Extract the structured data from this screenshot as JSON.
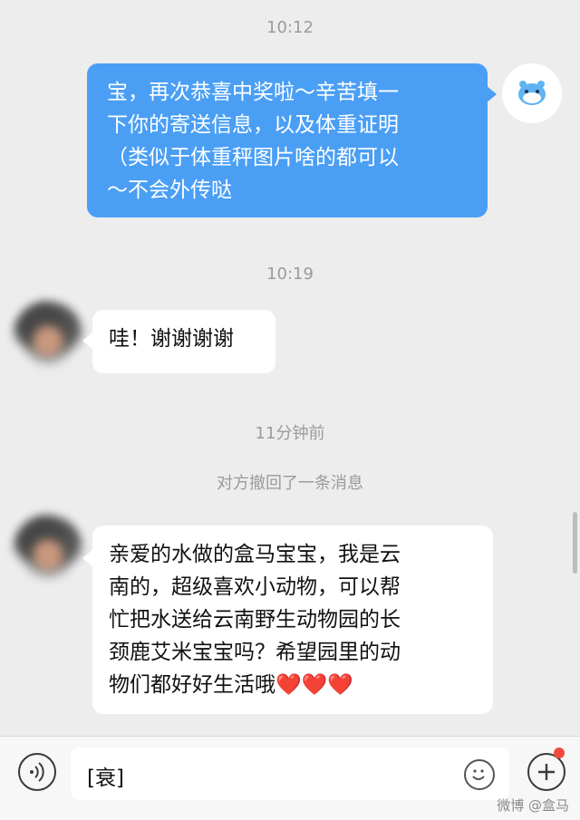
{
  "chat": {
    "timestamps": [
      "10:12",
      "10:19",
      "11分钟前"
    ],
    "messages": [
      {
        "from": "self",
        "lines": [
          "宝，再次恭喜中奖啦～辛苦填一",
          "下你的寄送信息，以及体重证明",
          "（类似于体重秤图片啥的都可以",
          "～不会外传哒"
        ]
      },
      {
        "from": "other",
        "lines": [
          "哇！谢谢谢谢"
        ]
      },
      {
        "from": "other",
        "lines": [
          "亲爱的水做的盒马宝宝，我是云",
          "南的，超级喜欢小动物，可以帮",
          "忙把水送给云南野生动物园的长",
          "颈鹿艾米宝宝吗？希望园里的动",
          "物们都好好生活哦"
        ],
        "trailing_emoji": "❤️❤️❤️"
      }
    ],
    "system_notes": [
      "对方撤回了一条消息"
    ]
  },
  "input_bar": {
    "text_value": "[衰]",
    "voice_icon": "voice-icon",
    "emoji_icon": "emoji-icon",
    "plus_icon": "plus-icon",
    "has_notification_dot": true
  },
  "watermark": "微博 @盒马",
  "colors": {
    "outgoing_bubble": "#4a9ff5",
    "incoming_bubble": "#ffffff",
    "background": "#ededed",
    "notification_dot": "#f04b3c",
    "heart": "#e8302c"
  }
}
